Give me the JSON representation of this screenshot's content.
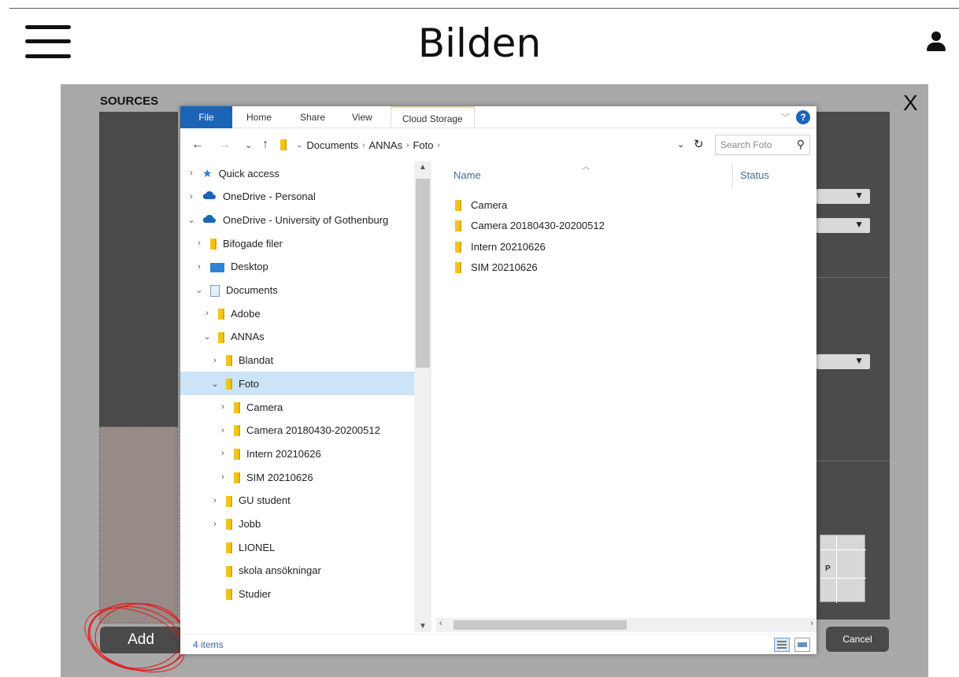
{
  "app": {
    "title": "Bilden"
  },
  "modal": {
    "sources_label": "SOURCES",
    "close_label": "X",
    "add_label": "Add",
    "cancel_label": "Cancel",
    "thumb_label": "P"
  },
  "explorer": {
    "ribbon_tabs": [
      "File",
      "Home",
      "Share",
      "View",
      "Cloud Storage"
    ],
    "help_label": "?",
    "breadcrumbs": [
      "Documents",
      "ANNAs",
      "Foto"
    ],
    "search_placeholder": "Search Foto",
    "columns": {
      "name": "Name",
      "status": "Status"
    },
    "tree": [
      {
        "label": "Quick access",
        "icon": "star-icon",
        "expander": "›"
      },
      {
        "label": "OneDrive - Personal",
        "icon": "cloud-icon",
        "expander": "›"
      },
      {
        "label": "OneDrive - University of Gothenburg",
        "icon": "cloud-icon",
        "expander": "⌄"
      },
      {
        "label": "Bifogade filer",
        "icon": "folder-icon",
        "expander": "›"
      },
      {
        "label": "Desktop",
        "icon": "desktop-icon",
        "expander": "›"
      },
      {
        "label": "Documents",
        "icon": "documents-icon",
        "expander": "⌄"
      },
      {
        "label": "Adobe",
        "icon": "folder-icon",
        "expander": "›"
      },
      {
        "label": "ANNAs",
        "icon": "folder-icon",
        "expander": "⌄"
      },
      {
        "label": "Blandat",
        "icon": "folder-icon",
        "expander": "›"
      },
      {
        "label": "Foto",
        "icon": "folder-icon",
        "expander": "⌄",
        "selected": true
      },
      {
        "label": "Camera",
        "icon": "folder-icon",
        "expander": "›"
      },
      {
        "label": "Camera 20180430-20200512",
        "icon": "folder-icon",
        "expander": "›"
      },
      {
        "label": "Intern 20210626",
        "icon": "folder-icon",
        "expander": "›"
      },
      {
        "label": "SIM 20210626",
        "icon": "folder-icon",
        "expander": "›"
      },
      {
        "label": "GU student",
        "icon": "folder-icon",
        "expander": "›"
      },
      {
        "label": "Jobb",
        "icon": "folder-icon",
        "expander": "›"
      },
      {
        "label": "LIONEL",
        "icon": "folder-icon",
        "expander": ""
      },
      {
        "label": "skola ansökningar",
        "icon": "folder-icon",
        "expander": ""
      },
      {
        "label": "Studier",
        "icon": "folder-icon",
        "expander": ""
      }
    ],
    "files": [
      {
        "name": "Camera",
        "icon": "folder-icon"
      },
      {
        "name": "Camera 20180430-20200512",
        "icon": "folder-icon"
      },
      {
        "name": "Intern 20210626",
        "icon": "folder-icon"
      },
      {
        "name": "SIM 20210626",
        "icon": "folder-icon"
      }
    ],
    "item_count": "4 items"
  },
  "colors": {
    "accent": "#1c64b8",
    "selected_row": "#cce4f7",
    "folder": "#f5c318",
    "annotation": "#e02020"
  }
}
